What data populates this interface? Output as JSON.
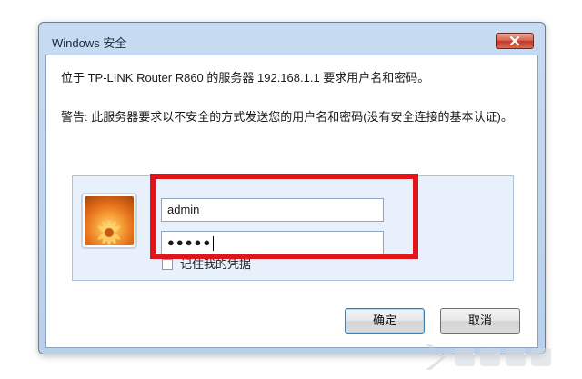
{
  "window": {
    "title": "Windows 安全",
    "close_icon": "close-icon"
  },
  "message": {
    "line1": "位于 TP-LINK Router R860 的服务器 192.168.1.1 要求用户名和密码。",
    "warning": "警告: 此服务器要求以不安全的方式发送您的用户名和密码(没有安全连接的基本认证)。"
  },
  "credentials": {
    "avatar_icon": "flower-avatar-icon",
    "username_value": "admin",
    "password_value": "●●●●●",
    "remember_label": "记住我的凭据",
    "remember_checked": false
  },
  "buttons": {
    "ok_label": "确定",
    "cancel_label": "取消"
  },
  "colors": {
    "highlight": "#e0141b",
    "title_bar": "#c7dbf2",
    "close_button": "#c0392b"
  }
}
